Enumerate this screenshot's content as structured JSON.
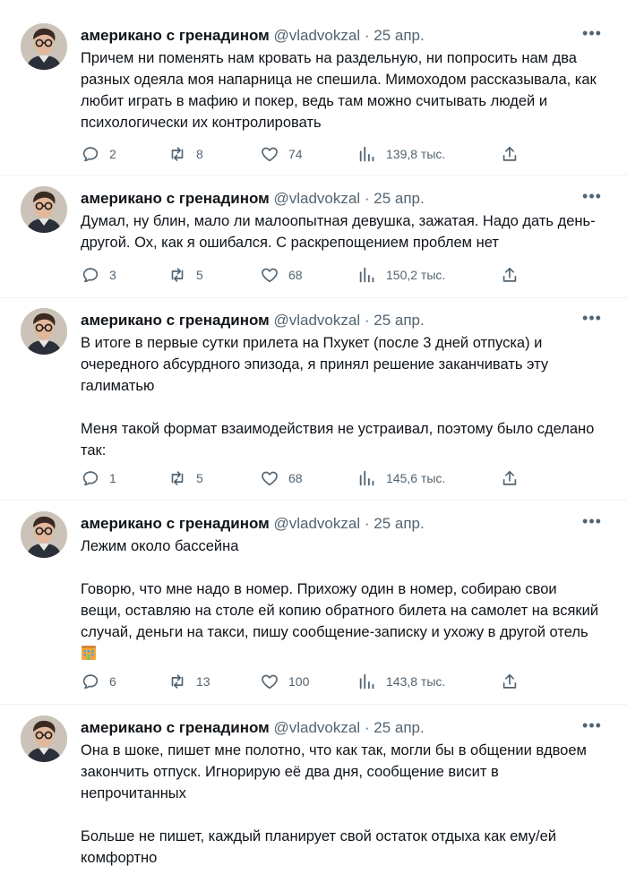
{
  "tweets": [
    {
      "name": "американо с гренадином",
      "handle": "@vladvokzal",
      "sep": "·",
      "date": "25 апр.",
      "text": "Причем ни поменять нам кровать на раздельную, ни попросить нам два разных одеяла моя напарница не спешила. Мимоходом рассказывала, как любит играть в мафию и покер, ведь там можно считывать людей и психологически их контролировать",
      "replies": "2",
      "retweets": "8",
      "likes": "74",
      "views": "139,8 тыс."
    },
    {
      "name": "американо с гренадином",
      "handle": "@vladvokzal",
      "sep": "·",
      "date": "25 апр.",
      "text": "Думал, ну блин, мало ли малоопытная девушка, зажатая. Надо дать день-другой. Ох, как я ошибался. С раскрепощением проблем нет",
      "replies": "3",
      "retweets": "5",
      "likes": "68",
      "views": "150,2 тыс."
    },
    {
      "name": "американо с гренадином",
      "handle": "@vladvokzal",
      "sep": "·",
      "date": "25 апр.",
      "text": "В итоге в первые сутки прилета на Пхукет (после 3 дней отпуска) и очередного абсурдного эпизода, я принял решение заканчивать эту галиматью\n\nМеня такой формат взаимодействия не устраивал, поэтому было сделано так:",
      "replies": "1",
      "retweets": "5",
      "likes": "68",
      "views": "145,6 тыс."
    },
    {
      "name": "американо с гренадином",
      "handle": "@vladvokzal",
      "sep": "·",
      "date": "25 апр.",
      "text": "Лежим около бассейна\n\nГоворю, что мне надо в номер. Прихожу один в номер, собираю свои вещи, оставляю на столе ей копию обратного билета на самолет на всякий случай, деньги на такси, пишу сообщение-записку и ухожу в другой отель",
      "emoji": "hotel-emoji",
      "replies": "6",
      "retweets": "13",
      "likes": "100",
      "views": "143,8 тыс."
    },
    {
      "name": "американо с гренадином",
      "handle": "@vladvokzal",
      "sep": "·",
      "date": "25 апр.",
      "text": "Она в шоке, пишет мне полотно, что как так, могли бы в общении вдвоем закончить отпуск. Игнорирую её два дня, сообщение висит в непрочитанных\n\nБольше не пишет, каждый планирует свой остаток отдыха как ему/ей комфортно"
    }
  ],
  "icons": {
    "reply": "reply-icon",
    "retweet": "retweet-icon",
    "like": "like-icon",
    "views": "views-icon",
    "share": "share-icon",
    "more": "more-icon"
  },
  "colors": {
    "text": "#0f1419",
    "secondary": "#536471",
    "divider": "#eff3f4"
  }
}
